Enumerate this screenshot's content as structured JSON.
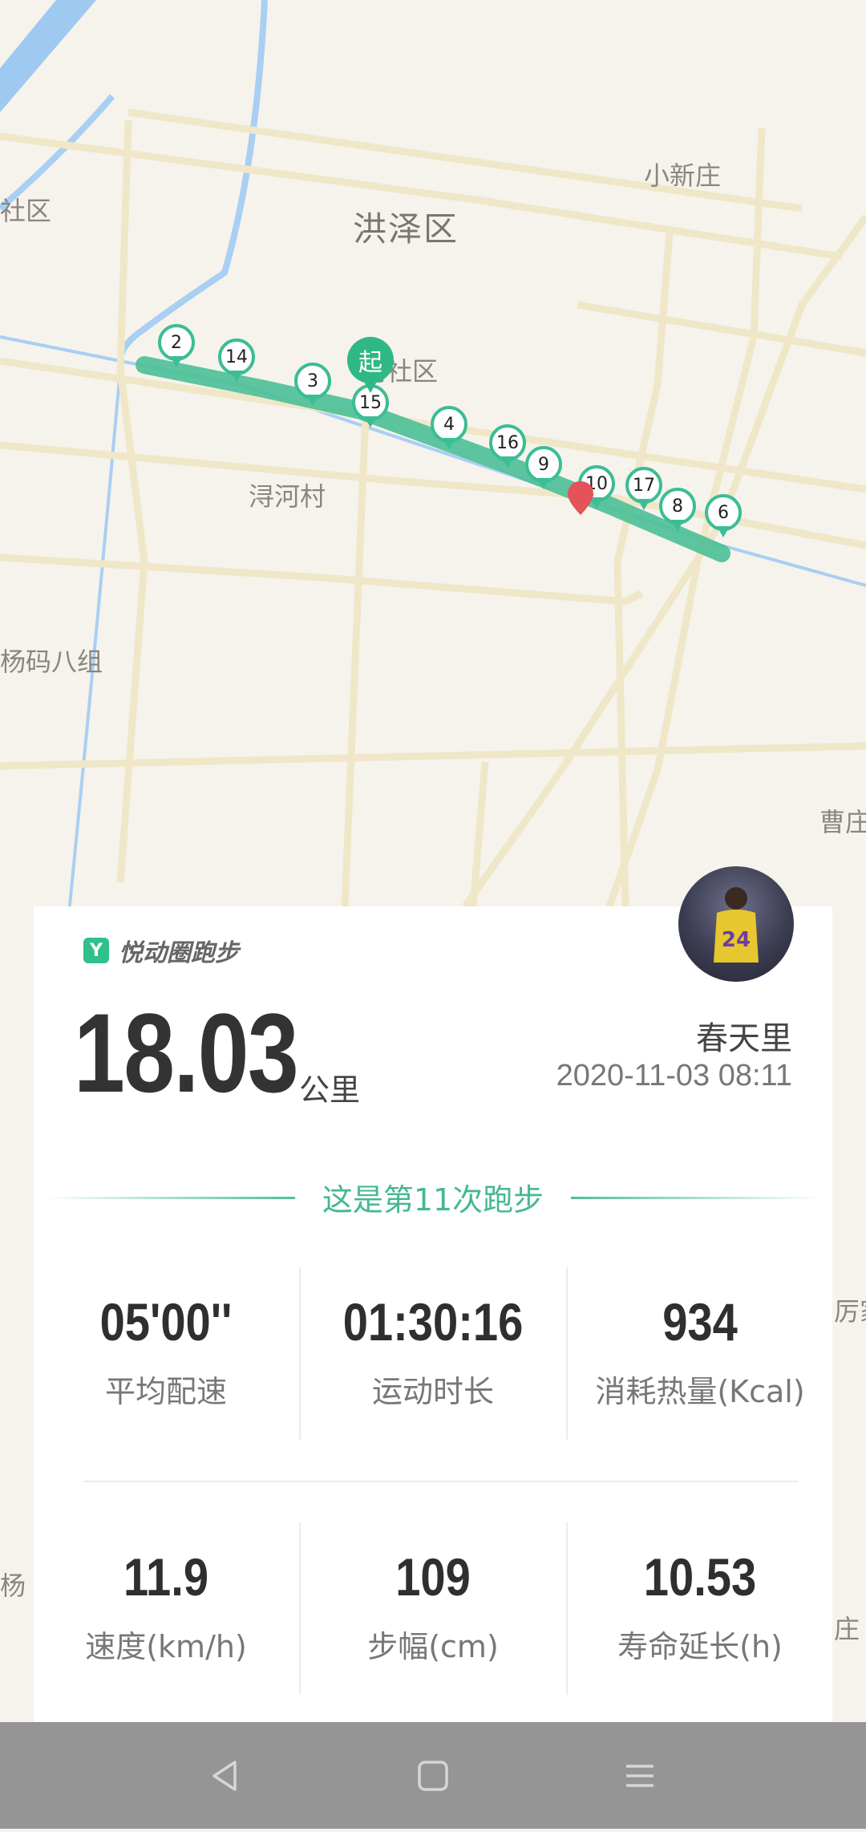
{
  "map": {
    "labels": {
      "district": "洪泽区",
      "xiaoxinzhuang": "小新庄",
      "community_left": "社区",
      "community_center": "河社区",
      "xunhecun": "浔河村",
      "yangma": "杨码八组",
      "caozhuang": "曹庄",
      "lijia": "厉家",
      "yang": "杨",
      "zhuang": "庄"
    },
    "start_label": "起",
    "km_markers": [
      "2",
      "14",
      "3",
      "15",
      "4",
      "16",
      "9",
      "10",
      "17",
      "8",
      "6"
    ]
  },
  "card": {
    "brand_name": "悦动圈跑步",
    "brand_icon": "Y",
    "distance": "18.03",
    "distance_unit": "公里",
    "username": "春天里",
    "datetime": "2020-11-03 08:11",
    "run_count_text": "这是第11次跑步",
    "stats": [
      {
        "value": "05'00''",
        "label": "平均配速"
      },
      {
        "value": "01:30:16",
        "label": "运动时长"
      },
      {
        "value": "934",
        "label": "消耗热量(Kcal)"
      },
      {
        "value": "11.9",
        "label": "速度(km/h)"
      },
      {
        "value": "109",
        "label": "步幅(cm)"
      },
      {
        "value": "10.53",
        "label": "寿命延长(h)"
      }
    ]
  },
  "colors": {
    "accent": "#3bbd95",
    "route": "#4bbf96",
    "end_marker": "#e4525a"
  },
  "navbar": {
    "icons": [
      "back-icon",
      "home-icon",
      "menu-icon"
    ]
  }
}
